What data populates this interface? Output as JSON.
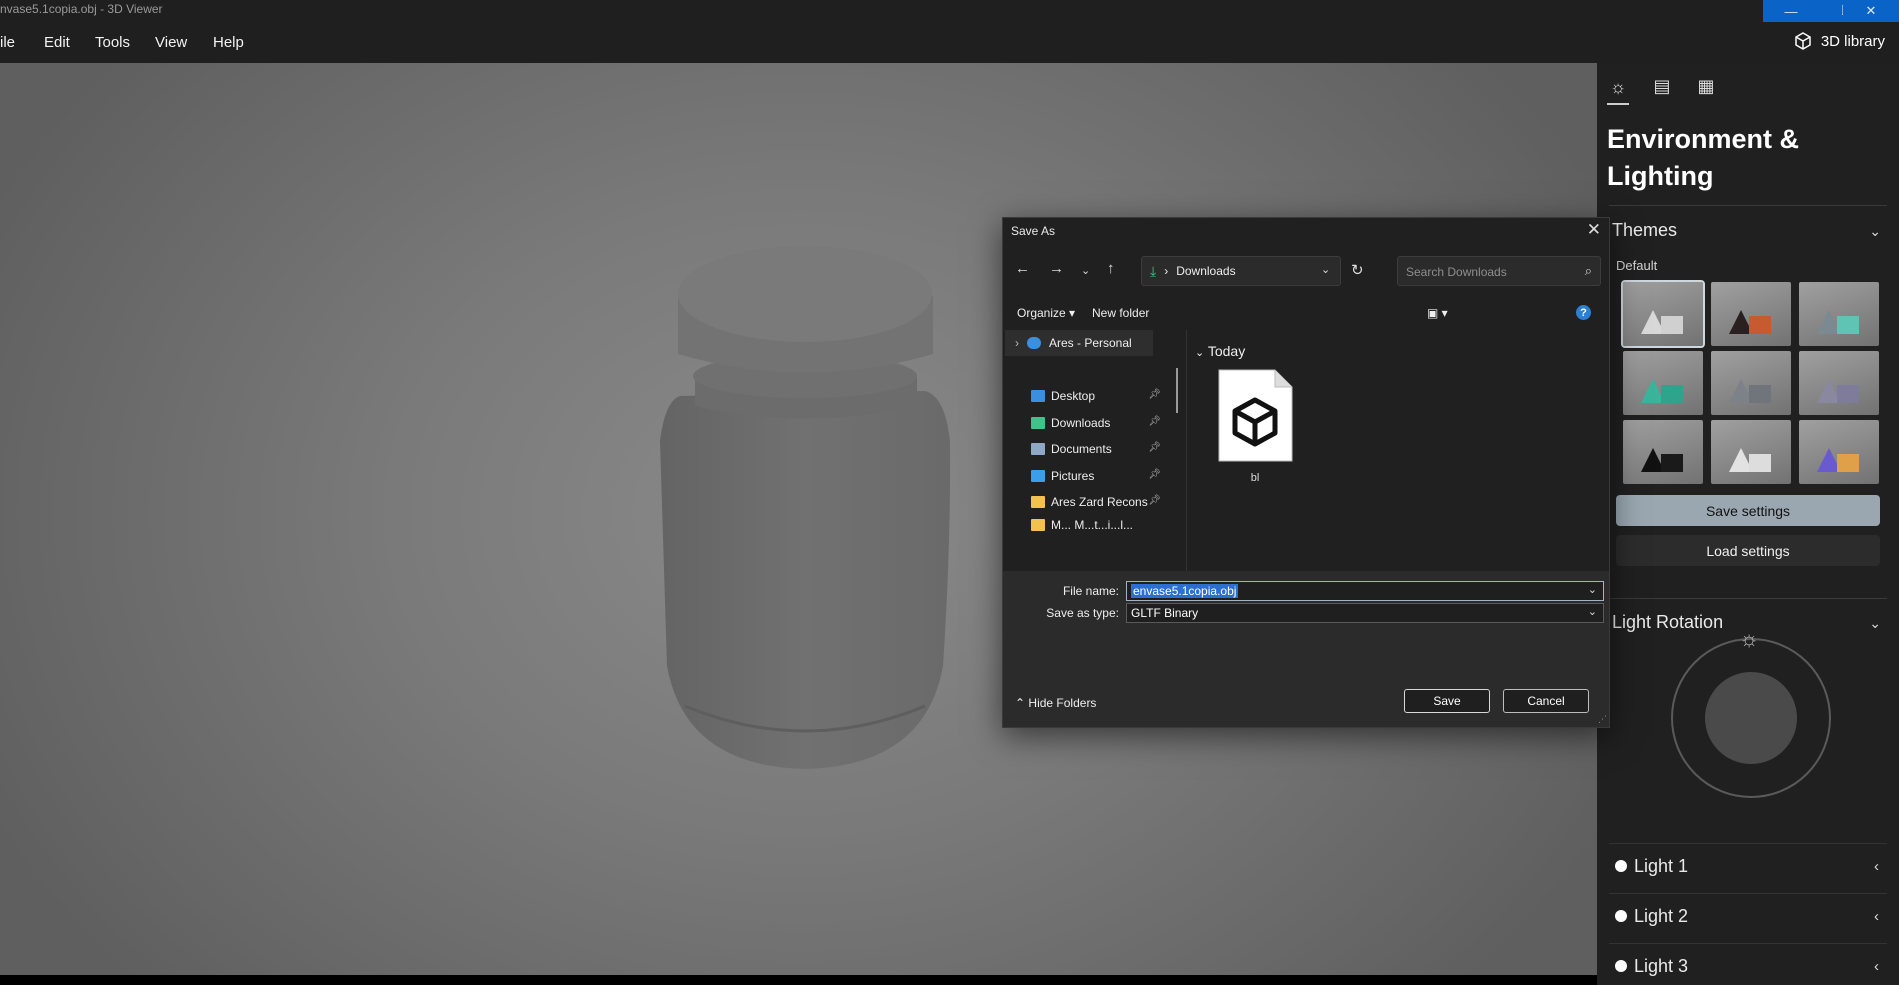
{
  "window": {
    "title": "nvase5.1copia.obj - 3D Viewer",
    "controls": {
      "minimize": "—",
      "maximize": "❐",
      "close": "✕"
    }
  },
  "menu": {
    "items": [
      "ile",
      "Edit",
      "Tools",
      "View",
      "Help"
    ],
    "library_label": "3D library"
  },
  "panel": {
    "heading": "Environment & Lighting",
    "themes": {
      "title": "Themes",
      "selected_label": "Default",
      "tiles": [
        {
          "c1": "#d8d8d8",
          "c2": "#d0d0d0"
        },
        {
          "c1": "#2a2020",
          "c2": "#c75a2e"
        },
        {
          "c1": "#7a8a90",
          "c2": "#5ec4b4"
        },
        {
          "c1": "#39b59c",
          "c2": "#2fa48c"
        },
        {
          "c1": "#7d8288",
          "c2": "#6f757a"
        },
        {
          "c1": "#8a88a0",
          "c2": "#7e7c9a"
        },
        {
          "c1": "#111111",
          "c2": "#1a1a1a"
        },
        {
          "c1": "#e2e2e2",
          "c2": "#dddddd"
        },
        {
          "c1": "#6a5ad0",
          "c2": "#e0a04a"
        }
      ]
    },
    "save_settings": "Save settings",
    "load_settings": "Load settings",
    "light_rotation": "Light Rotation",
    "lights": [
      "Light 1",
      "Light 2",
      "Light 3"
    ],
    "colors": {
      "accent": "#9aa7b0",
      "background": "#202020"
    }
  },
  "dialog": {
    "title": "Save As",
    "address": "Downloads",
    "search_placeholder": "Search Downloads",
    "organize": "Organize",
    "new_folder": "New folder",
    "help": "?",
    "nav": {
      "onedrive": "Ares - Personal",
      "items": [
        {
          "label": "Desktop",
          "color": "#3a8fe0"
        },
        {
          "label": "Downloads",
          "color": "#3ec48a"
        },
        {
          "label": "Documents",
          "color": "#8fa8c8"
        },
        {
          "label": "Pictures",
          "color": "#3a9ee8"
        },
        {
          "label": "Ares Zard Recons",
          "color": "#f2c14e"
        },
        {
          "label": "M... M...t...i...l...",
          "color": "#f2c14e"
        }
      ]
    },
    "group_today": "Today",
    "files": [
      {
        "name": "bl",
        "icon": "3d-object-icon"
      }
    ],
    "file_name_label": "File name:",
    "file_name_value": "envase5.1copia.obj",
    "save_type_label": "Save as type:",
    "save_type_value": "GLTF Binary",
    "hide_folders": "Hide Folders",
    "save_button": "Save",
    "cancel_button": "Cancel"
  }
}
